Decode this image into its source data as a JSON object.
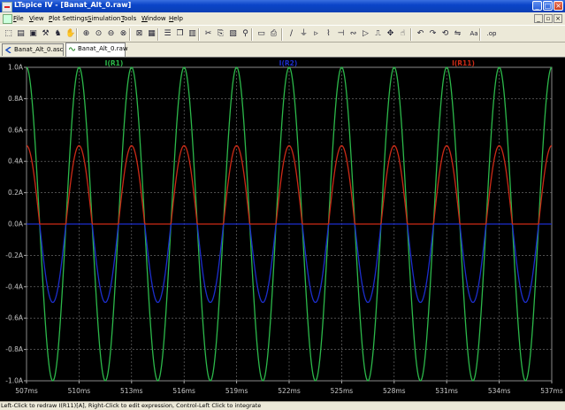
{
  "window": {
    "title": "LTspice IV - [Banat_Alt_0.raw]"
  },
  "menu": [
    {
      "label": "File",
      "accel": "F",
      "rest": "ile"
    },
    {
      "label": "View",
      "accel": "V",
      "rest": "iew"
    },
    {
      "label": "Plot Settings",
      "accel": "P",
      "rest": "lot Settings"
    },
    {
      "label": "Simulation",
      "accel": "S",
      "rest": "imulation"
    },
    {
      "label": "Tools",
      "accel": "T",
      "rest": "ools"
    },
    {
      "label": "Window",
      "accel": "W",
      "rest": "indow"
    },
    {
      "label": "Help",
      "accel": "H",
      "rest": "elp"
    }
  ],
  "tabs": [
    {
      "label": "Banat_Alt_0.asc",
      "active": false
    },
    {
      "label": "Banat_Alt_0.raw",
      "active": true
    }
  ],
  "toolbar_icons": [
    "open-schematic-icon",
    "open-file-icon",
    "save-icon",
    "control-panel-icon",
    "run-icon",
    "halt-icon",
    "zoom-in-icon",
    "zoom-area-icon",
    "zoom-out-icon",
    "zoom-full-icon",
    "autorange-icon",
    "ruler-icon",
    "tile-horizontal-icon",
    "cascade-icon",
    "tile-vertical-icon",
    "cut-icon",
    "copy-icon",
    "paste-icon",
    "find-icon",
    "print-preview-icon",
    "print-icon",
    "wire-icon",
    "ground-icon",
    "label-net-icon",
    "resistor-icon",
    "capacitor-icon",
    "inductor-icon",
    "diode-icon",
    "component-icon",
    "move-icon",
    "drag-icon",
    "undo-icon",
    "redo-icon",
    "rotate-icon",
    "mirror-icon",
    "text-icon",
    "spice-directive-icon"
  ],
  "legend": [
    {
      "label": "I(R1)",
      "color": "#2cb84a"
    },
    {
      "label": "I(R2)",
      "color": "#1c2ecc"
    },
    {
      "label": "I(R11)",
      "color": "#cc2a16"
    }
  ],
  "chart_data": {
    "type": "line",
    "xlim": [
      507,
      537
    ],
    "x_unit": "ms",
    "ylim": [
      -1.0,
      1.0
    ],
    "x_ticks": [
      "507ms",
      "510ms",
      "513ms",
      "516ms",
      "519ms",
      "522ms",
      "525ms",
      "528ms",
      "531ms",
      "534ms",
      "537ms"
    ],
    "y_ticks": [
      "1.0A",
      "0.8A",
      "0.6A",
      "0.4A",
      "0.2A",
      "0.0A",
      "-0.2A",
      "-0.4A",
      "-0.6A",
      "-0.8A",
      "-1.0A"
    ],
    "grid": true,
    "series": [
      {
        "name": "I(R1)",
        "color": "#2cb84a",
        "kind": "sine",
        "amplitude": 1.0,
        "period_ms": 3.0,
        "peak_at_ms": 510.0
      },
      {
        "name": "I(R2)",
        "color": "#1c2ecc",
        "kind": "neg_half_wave",
        "amplitude": 0.5,
        "period_ms": 3.0,
        "peak_at_ms": 511.5
      },
      {
        "name": "I(R11)",
        "color": "#cc2a16",
        "kind": "pos_half_wave",
        "amplitude": 0.5,
        "period_ms": 3.0,
        "peak_at_ms": 510.0
      }
    ]
  },
  "status": {
    "text": "Left-Click to redraw I(R11)[A], Right-Click to edit expression, Control-Left Click to integrate"
  }
}
